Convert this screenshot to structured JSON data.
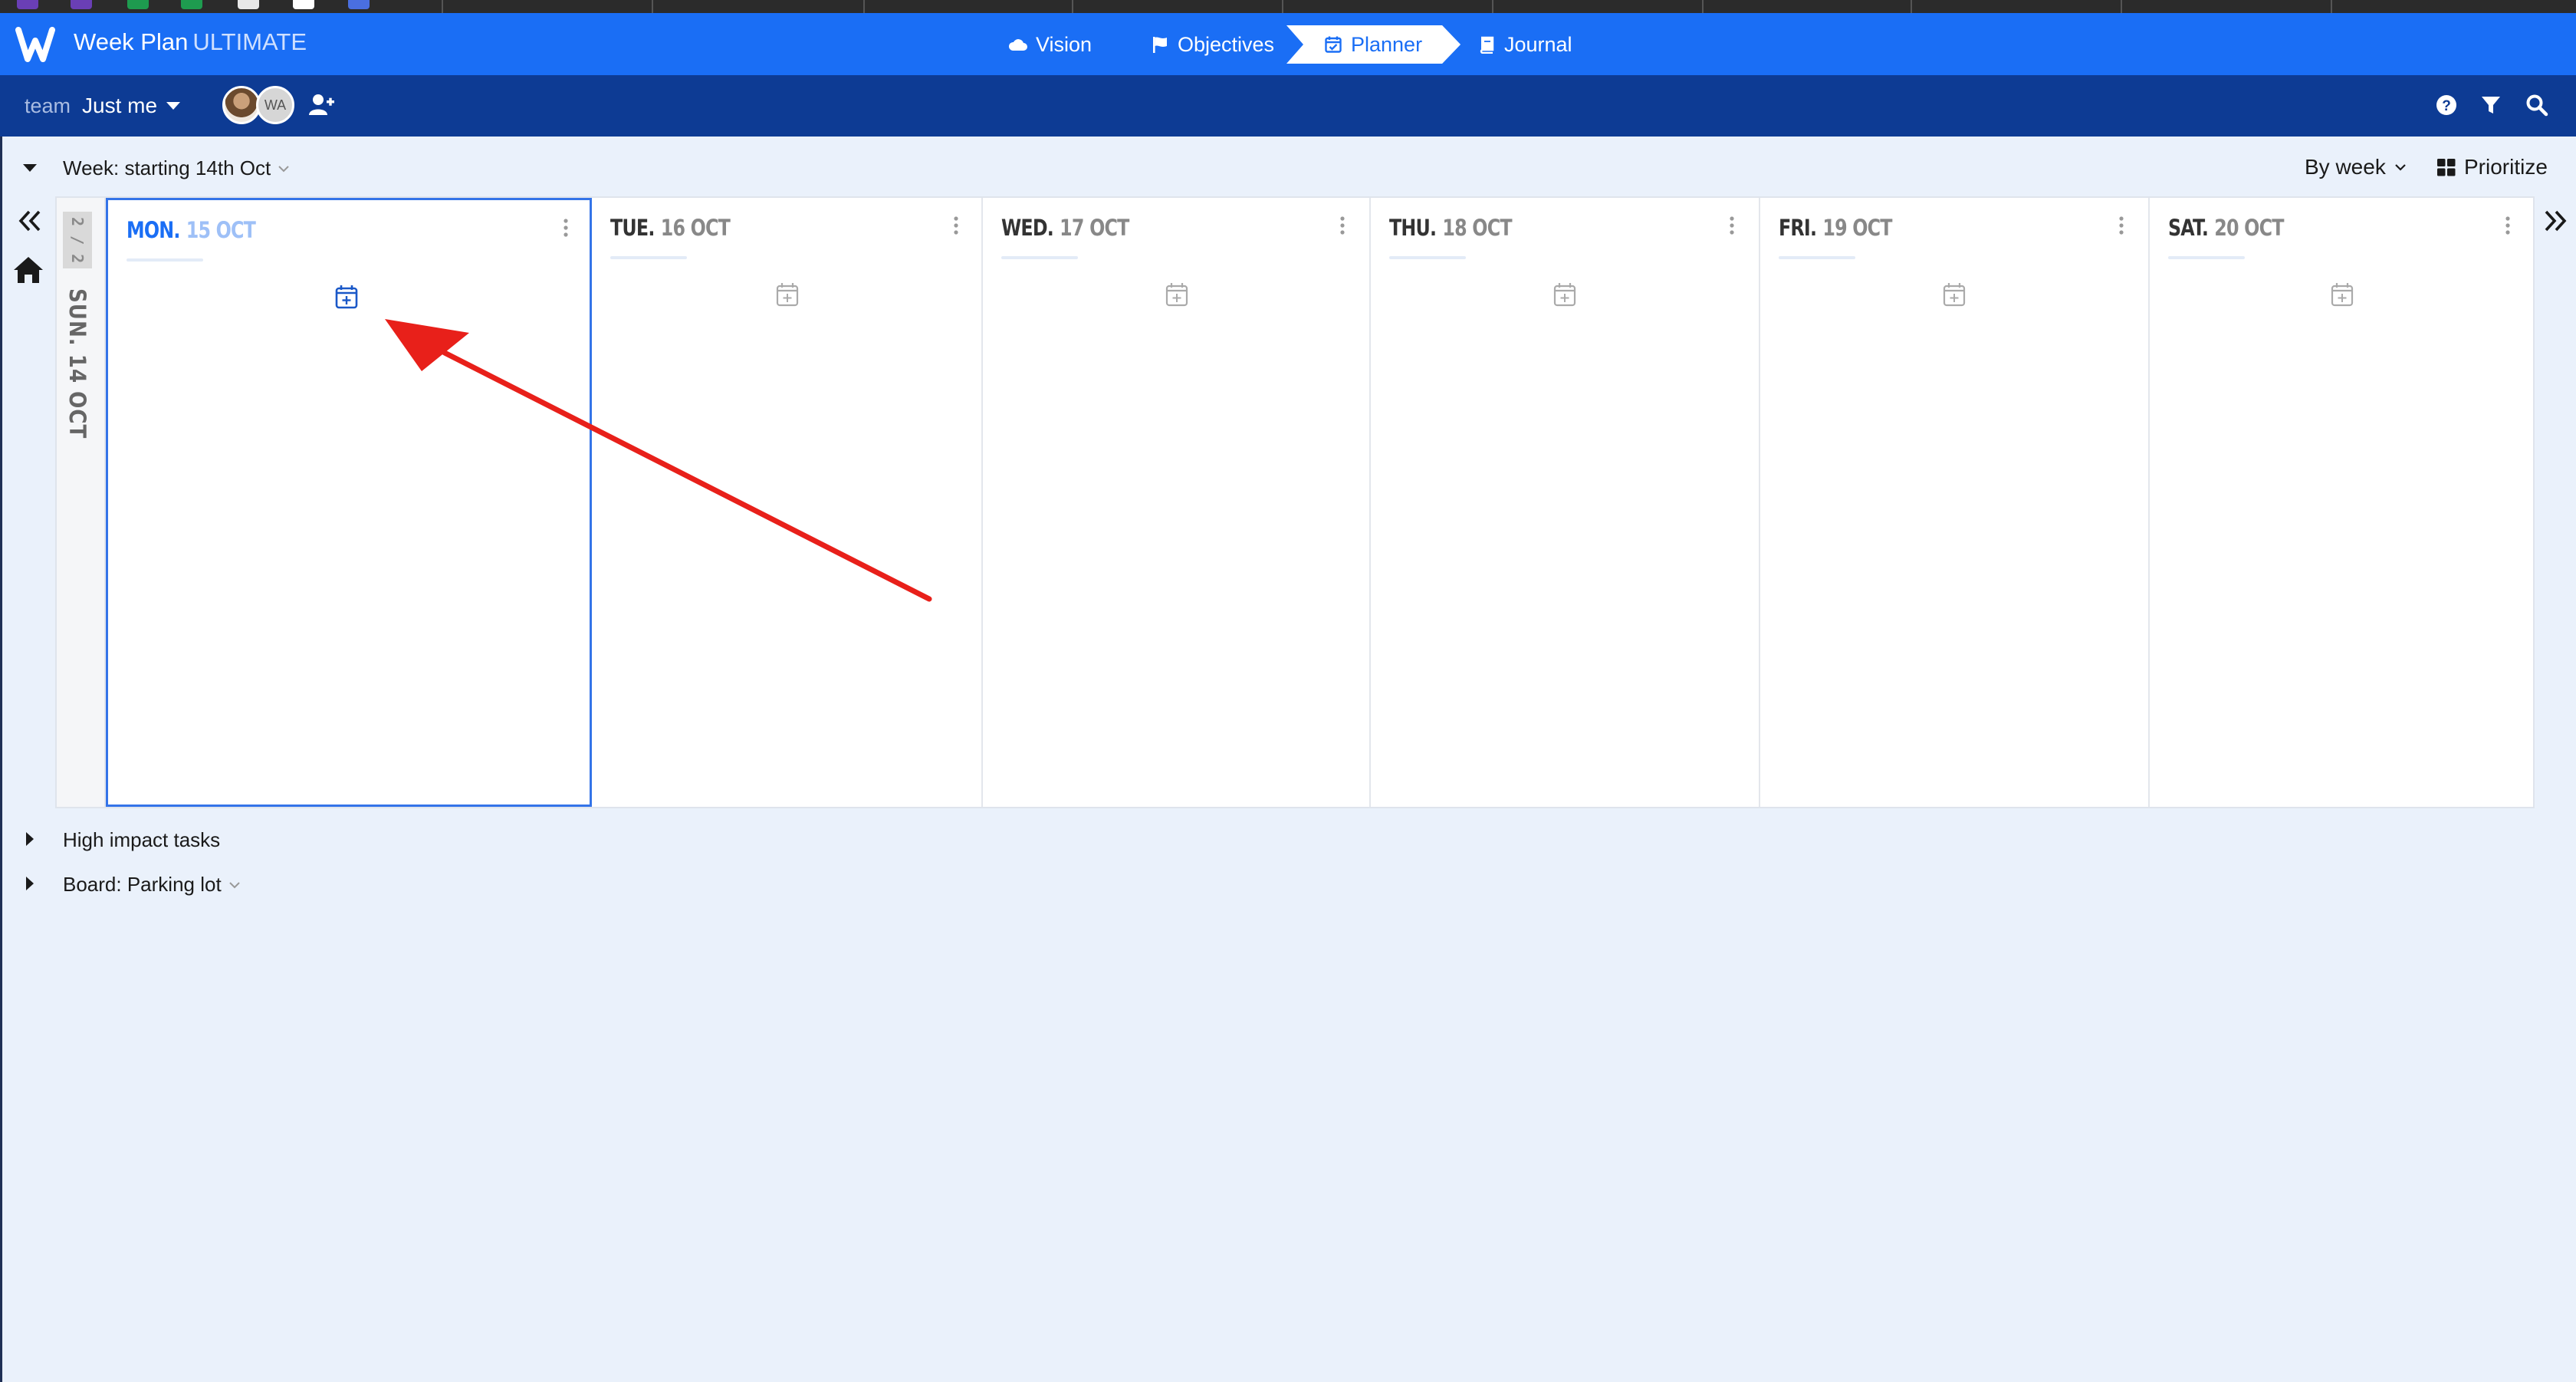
{
  "app": {
    "brand_name": "Week Plan",
    "brand_edition": "ULTIMATE",
    "accent_color": "#1a6ef5",
    "nav_dark_color": "#0d3b94"
  },
  "nav": {
    "tabs": [
      {
        "label": "Vision",
        "icon": "cloud-icon",
        "active": false
      },
      {
        "label": "Objectives",
        "icon": "flag-icon",
        "active": false
      },
      {
        "label": "Planner",
        "icon": "calendar-check-icon",
        "active": true
      },
      {
        "label": "Journal",
        "icon": "book-icon",
        "active": false
      }
    ]
  },
  "subbar": {
    "team_label": "team",
    "team_value": "Just me",
    "avatar_initials": "WA",
    "icons": [
      "question-circle-icon",
      "filter-icon",
      "search-icon"
    ]
  },
  "week": {
    "title": "Week: starting 14th Oct",
    "view_mode": "By week",
    "prioritize_label": "Prioritize",
    "page_indicator": "2 / 2",
    "collapsed_day": "SUN. 14 OCT",
    "days": [
      {
        "name": "MON.",
        "date": "15 OCT",
        "selected": true
      },
      {
        "name": "TUE.",
        "date": "16 OCT",
        "selected": false
      },
      {
        "name": "WED.",
        "date": "17 OCT",
        "selected": false
      },
      {
        "name": "THU.",
        "date": "18 OCT",
        "selected": false
      },
      {
        "name": "FRI.",
        "date": "19 OCT",
        "selected": false
      },
      {
        "name": "SAT.",
        "date": "20 OCT",
        "selected": false
      }
    ]
  },
  "sections": {
    "high_impact": "High impact tasks",
    "board": "Board: Parking lot"
  },
  "annotation": {
    "color": "#e8201a"
  }
}
